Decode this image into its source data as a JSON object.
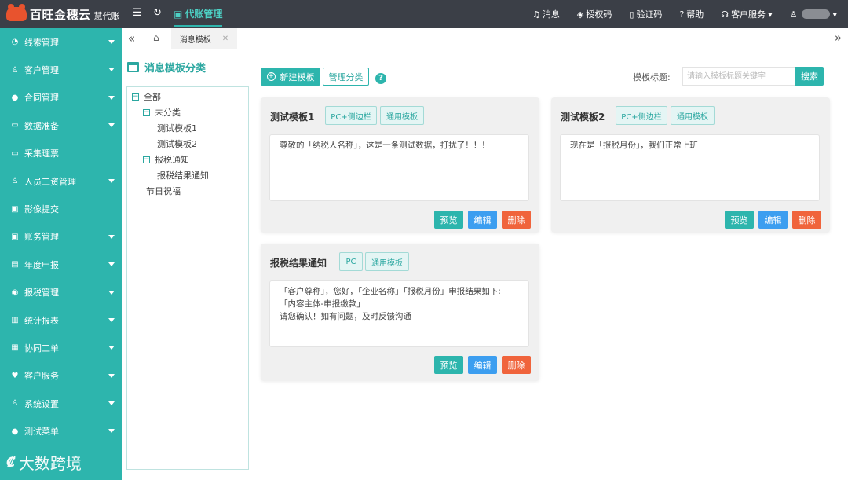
{
  "topbar": {
    "brand": "百旺金穗云",
    "brand_sub": "慧代账",
    "active_module": "代账管理",
    "right_items": [
      "消息",
      "授权码",
      "验证码",
      "帮助",
      "客户服务"
    ]
  },
  "sidebar": {
    "items": [
      {
        "label": "线索管理",
        "icon": "◔",
        "has_caret": true
      },
      {
        "label": "客户管理",
        "icon": "♙",
        "has_caret": true
      },
      {
        "label": "合同管理",
        "icon": "●",
        "has_caret": true
      },
      {
        "label": "数据准备",
        "icon": "▭",
        "has_caret": true
      },
      {
        "label": "采集理票",
        "icon": "▭",
        "has_caret": false
      },
      {
        "label": "人员工资管理",
        "icon": "♙",
        "has_caret": true
      },
      {
        "label": "影像提交",
        "icon": "▣",
        "has_caret": false
      },
      {
        "label": "账务管理",
        "icon": "▣",
        "has_caret": true
      },
      {
        "label": "年度申报",
        "icon": "▤",
        "has_caret": true
      },
      {
        "label": "报税管理",
        "icon": "◉",
        "has_caret": true
      },
      {
        "label": "统计报表",
        "icon": "▥",
        "has_caret": true
      },
      {
        "label": "协同工单",
        "icon": "▦",
        "has_caret": true
      },
      {
        "label": "客户服务",
        "icon": "♥",
        "has_caret": true
      },
      {
        "label": "系统设置",
        "icon": "♙",
        "has_caret": true
      },
      {
        "label": "测试菜单",
        "icon": "●",
        "has_caret": true
      }
    ],
    "watermark": "大数跨境"
  },
  "tabs": {
    "active": "消息模板"
  },
  "category": {
    "title": "消息模板分类",
    "tree": [
      {
        "label": "全部",
        "level": 0,
        "toggle": "−"
      },
      {
        "label": "未分类",
        "level": 1,
        "toggle": "−"
      },
      {
        "label": "测试模板1",
        "level": 2,
        "toggle": ""
      },
      {
        "label": "测试模板2",
        "level": 2,
        "toggle": ""
      },
      {
        "label": "报税通知",
        "level": 1,
        "toggle": "−"
      },
      {
        "label": "报税结果通知",
        "level": 2,
        "toggle": ""
      },
      {
        "label": "节日祝福",
        "level": 1,
        "toggle": ""
      }
    ]
  },
  "toolbar": {
    "new_label": "新建模板",
    "manage_label": "管理分类",
    "search_label": "模板标题:",
    "search_placeholder": "请输入模板标题关键字",
    "search_button": "搜索"
  },
  "cards": [
    {
      "title": "测试模板1",
      "tags": [
        "PC+侧边栏",
        "通用模板"
      ],
      "body": [
        "尊敬的「纳税人名称」，这是一条测试数据，打扰了！！！"
      ]
    },
    {
      "title": "测试模板2",
      "tags": [
        "PC+侧边栏",
        "通用模板"
      ],
      "body": [
        "现在是「报税月份」，我们正常上班"
      ]
    },
    {
      "title": "报税结果通知",
      "tags": [
        "PC",
        "通用模板"
      ],
      "body": [
        "「客户尊称」，您好，「企业名称」「报税月份」申报结果如下:",
        "「内容主体-申报缴款」",
        "请您确认！如有问题，及时反馈沟通"
      ]
    }
  ],
  "card_actions": {
    "preview": "预览",
    "edit": "编辑",
    "delete": "删除"
  },
  "colors": {
    "primary": "#2db5ad",
    "edit": "#3c9ef0",
    "delete": "#f0643c",
    "topbar": "#3b3f47"
  }
}
